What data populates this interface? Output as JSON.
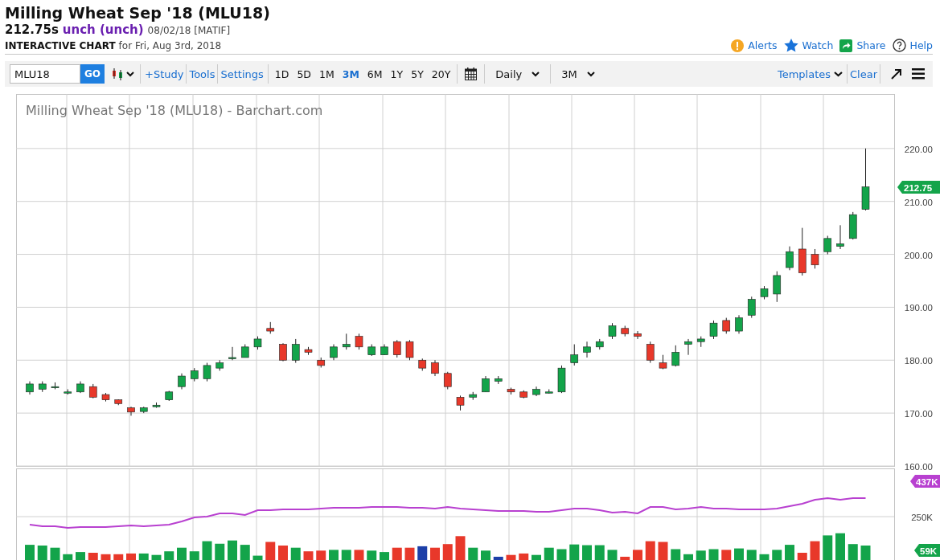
{
  "title": "Milling Wheat Sep '18 (MLU18)",
  "quote": {
    "price": "212.75s",
    "change": "unch (unch)",
    "date": "08/02/18 [MATIF]"
  },
  "chart_heading": {
    "label": "INTERACTIVE CHART",
    "date": "for Fri, Aug 3rd, 2018"
  },
  "links": [
    {
      "label": "Alerts",
      "kind": "alert"
    },
    {
      "label": "Watch",
      "kind": "watch"
    },
    {
      "label": "Share",
      "kind": "share"
    },
    {
      "label": "Help",
      "kind": "help"
    }
  ],
  "toolbar": {
    "symbol": "MLU18",
    "go": "GO",
    "links": [
      "+Study",
      "Tools",
      "Settings"
    ],
    "periods": [
      {
        "label": "1D",
        "selected": false
      },
      {
        "label": "5D",
        "selected": false
      },
      {
        "label": "1M",
        "selected": false
      },
      {
        "label": "3M",
        "selected": true
      },
      {
        "label": "6M",
        "selected": false
      },
      {
        "label": "1Y",
        "selected": false
      },
      {
        "label": "5Y",
        "selected": false
      },
      {
        "label": "20Y",
        "selected": false
      }
    ],
    "interval": "Daily",
    "range": "3M",
    "templates": "Templates",
    "clear": "Clear"
  },
  "chart": {
    "chart_data": {
      "type": "candlestick",
      "title": "Milling Wheat Sep '18 (MLU18) - Barchart.com",
      "ylim": [
        160,
        230.3
      ],
      "grid": true,
      "yticks": [
        {
          "value": 220,
          "label": "220.00"
        },
        {
          "value": 210,
          "label": "210.00"
        },
        {
          "value": 200,
          "label": "200.00"
        },
        {
          "value": 190,
          "label": "190.00"
        },
        {
          "value": 180,
          "label": "180.00"
        },
        {
          "value": 170,
          "label": "170.00"
        },
        {
          "value": 160,
          "label": "160.00"
        }
      ],
      "ohlc": [
        [
          174,
          176,
          173.5,
          175.5
        ],
        [
          174.5,
          176,
          174,
          175.5
        ],
        [
          175,
          175.8,
          174.5,
          175
        ],
        [
          174,
          174.5,
          173.5,
          174
        ],
        [
          174,
          176,
          173.8,
          175.5
        ],
        [
          175,
          175.5,
          172.8,
          173
        ],
        [
          173.5,
          173.8,
          172.2,
          172.5
        ],
        [
          172.5,
          172.6,
          171.5,
          171.8
        ],
        [
          171,
          171.2,
          169.5,
          170.2
        ],
        [
          170.3,
          171.2,
          170,
          171
        ],
        [
          171.2,
          172,
          171,
          171.5
        ],
        [
          172.5,
          174.2,
          172.3,
          174
        ],
        [
          175,
          177.5,
          174.5,
          177
        ],
        [
          176.5,
          178.5,
          176,
          178
        ],
        [
          176.5,
          179.5,
          176,
          179
        ],
        [
          178.5,
          180,
          178,
          179.5
        ],
        [
          180.5,
          182.5,
          180,
          180.5
        ],
        [
          180.5,
          183,
          180.5,
          182.5
        ],
        [
          182.5,
          184.5,
          182,
          184
        ],
        [
          186,
          187.2,
          185,
          185.5
        ],
        [
          183,
          183.2,
          179.8,
          180
        ],
        [
          180,
          184,
          179.5,
          183
        ],
        [
          182,
          182.5,
          181,
          181.5
        ],
        [
          180,
          180.5,
          178.6,
          179
        ],
        [
          180.5,
          183,
          180,
          182.5
        ],
        [
          182.5,
          185,
          182,
          183
        ],
        [
          184.5,
          185,
          182,
          182.5
        ],
        [
          181,
          183,
          180.8,
          182.5
        ],
        [
          181,
          183,
          181,
          182.5
        ],
        [
          183.5,
          183.8,
          180.5,
          181
        ],
        [
          183.5,
          183.8,
          180,
          180.5
        ],
        [
          180,
          180.3,
          178,
          178.5
        ],
        [
          179.5,
          180,
          177,
          177.5
        ],
        [
          177.5,
          177.8,
          174.5,
          175
        ],
        [
          173,
          173.3,
          170.5,
          171.5
        ],
        [
          173,
          174,
          172.5,
          173.5
        ],
        [
          174,
          177,
          174,
          176.5
        ],
        [
          176,
          177,
          175.5,
          176.5
        ],
        [
          174.5,
          174.8,
          173.5,
          174
        ],
        [
          174,
          174.3,
          172.8,
          173
        ],
        [
          173.5,
          175,
          173.2,
          174.5
        ],
        [
          174,
          174.5,
          173.7,
          174
        ],
        [
          174,
          179,
          173.8,
          178.5
        ],
        [
          179.5,
          183,
          179,
          181
        ],
        [
          181.5,
          183.5,
          180.5,
          182.5
        ],
        [
          182.5,
          184,
          182,
          183.5
        ],
        [
          184.5,
          187,
          184,
          186.5
        ],
        [
          186,
          186.5,
          184.5,
          185
        ],
        [
          185,
          185.5,
          184,
          184.5
        ],
        [
          183,
          183.5,
          179.5,
          180
        ],
        [
          179.5,
          181,
          178.3,
          178.5
        ],
        [
          179,
          182.8,
          178.8,
          181.5
        ],
        [
          183,
          184,
          181,
          183.5
        ],
        [
          183.5,
          184.5,
          182.5,
          184
        ],
        [
          184.5,
          187.5,
          184,
          187
        ],
        [
          187.5,
          188,
          185,
          185.5
        ],
        [
          185.5,
          188.5,
          185,
          188
        ],
        [
          188.5,
          192,
          188,
          191.5
        ],
        [
          192,
          194,
          191.5,
          193.5
        ],
        [
          192.5,
          196.8,
          191,
          196
        ],
        [
          197.5,
          201.5,
          197,
          200.5
        ],
        [
          201,
          205,
          196,
          196.5
        ],
        [
          200,
          201,
          197.3,
          198
        ],
        [
          200.5,
          203.5,
          200,
          203
        ],
        [
          201.5,
          205.5,
          201,
          202
        ],
        [
          203,
          208,
          202.8,
          207.5
        ],
        [
          208.5,
          220,
          208.3,
          212.75
        ]
      ]
    },
    "volume_axis": [
      "250K"
    ],
    "last_price": "212.75",
    "open_interest": "437K",
    "volume": "59K"
  }
}
